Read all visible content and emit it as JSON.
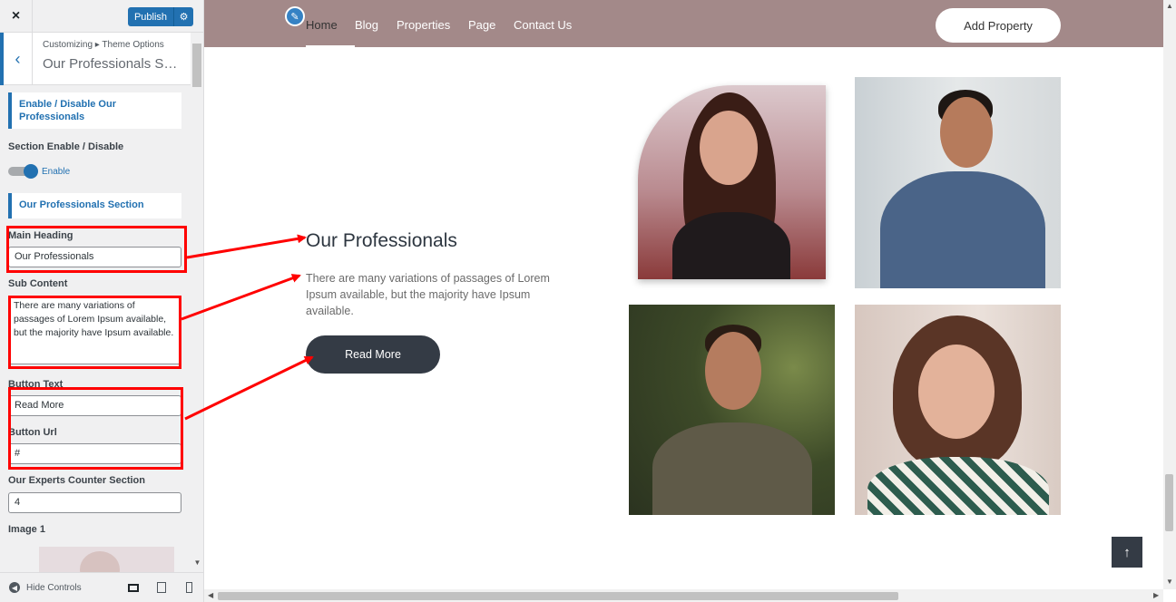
{
  "sidebar": {
    "close_icon": "×",
    "publish_label": "Publish",
    "gear_icon": "⚙",
    "breadcrumb": "Customizing ▸ Theme Options",
    "section_title": "Our Professionals Set...",
    "back_icon": "‹",
    "enable_heading": "Enable / Disable Our Professionals",
    "section_enable_label": "Section Enable / Disable",
    "toggle_state": "Enable",
    "section_heading": "Our Professionals Section",
    "main_heading_label": "Main Heading",
    "main_heading_value": "Our Professionals",
    "sub_content_label": "Sub Content",
    "sub_content_value": "There are many variations of passages of Lorem Ipsum available, but the majority have Ipsum available.",
    "button_text_label": "Button Text",
    "button_text_value": "Read More",
    "button_url_label": "Button Url",
    "button_url_value": "#",
    "counter_label": "Our Experts Counter Section",
    "counter_value": "4",
    "image_label": "Image 1",
    "hide_controls": "Hide Controls",
    "hide_icon": "◀"
  },
  "preview": {
    "nav": {
      "links": [
        "Home",
        "Blog",
        "Properties",
        "Page",
        "Contact Us"
      ],
      "active": "Home",
      "cta": "Add Property",
      "pencil_icon": "✎"
    },
    "heading": "Our Professionals",
    "sub": "There are many variations of passages of Lorem Ipsum available, but the majority have Ipsum available.",
    "button": "Read More",
    "scroll_top_icon": "↑"
  },
  "colors": {
    "accent": "#2271b1",
    "nav_bg": "#a38989",
    "dark_button": "#343b45",
    "annotation": "#ff0000"
  }
}
